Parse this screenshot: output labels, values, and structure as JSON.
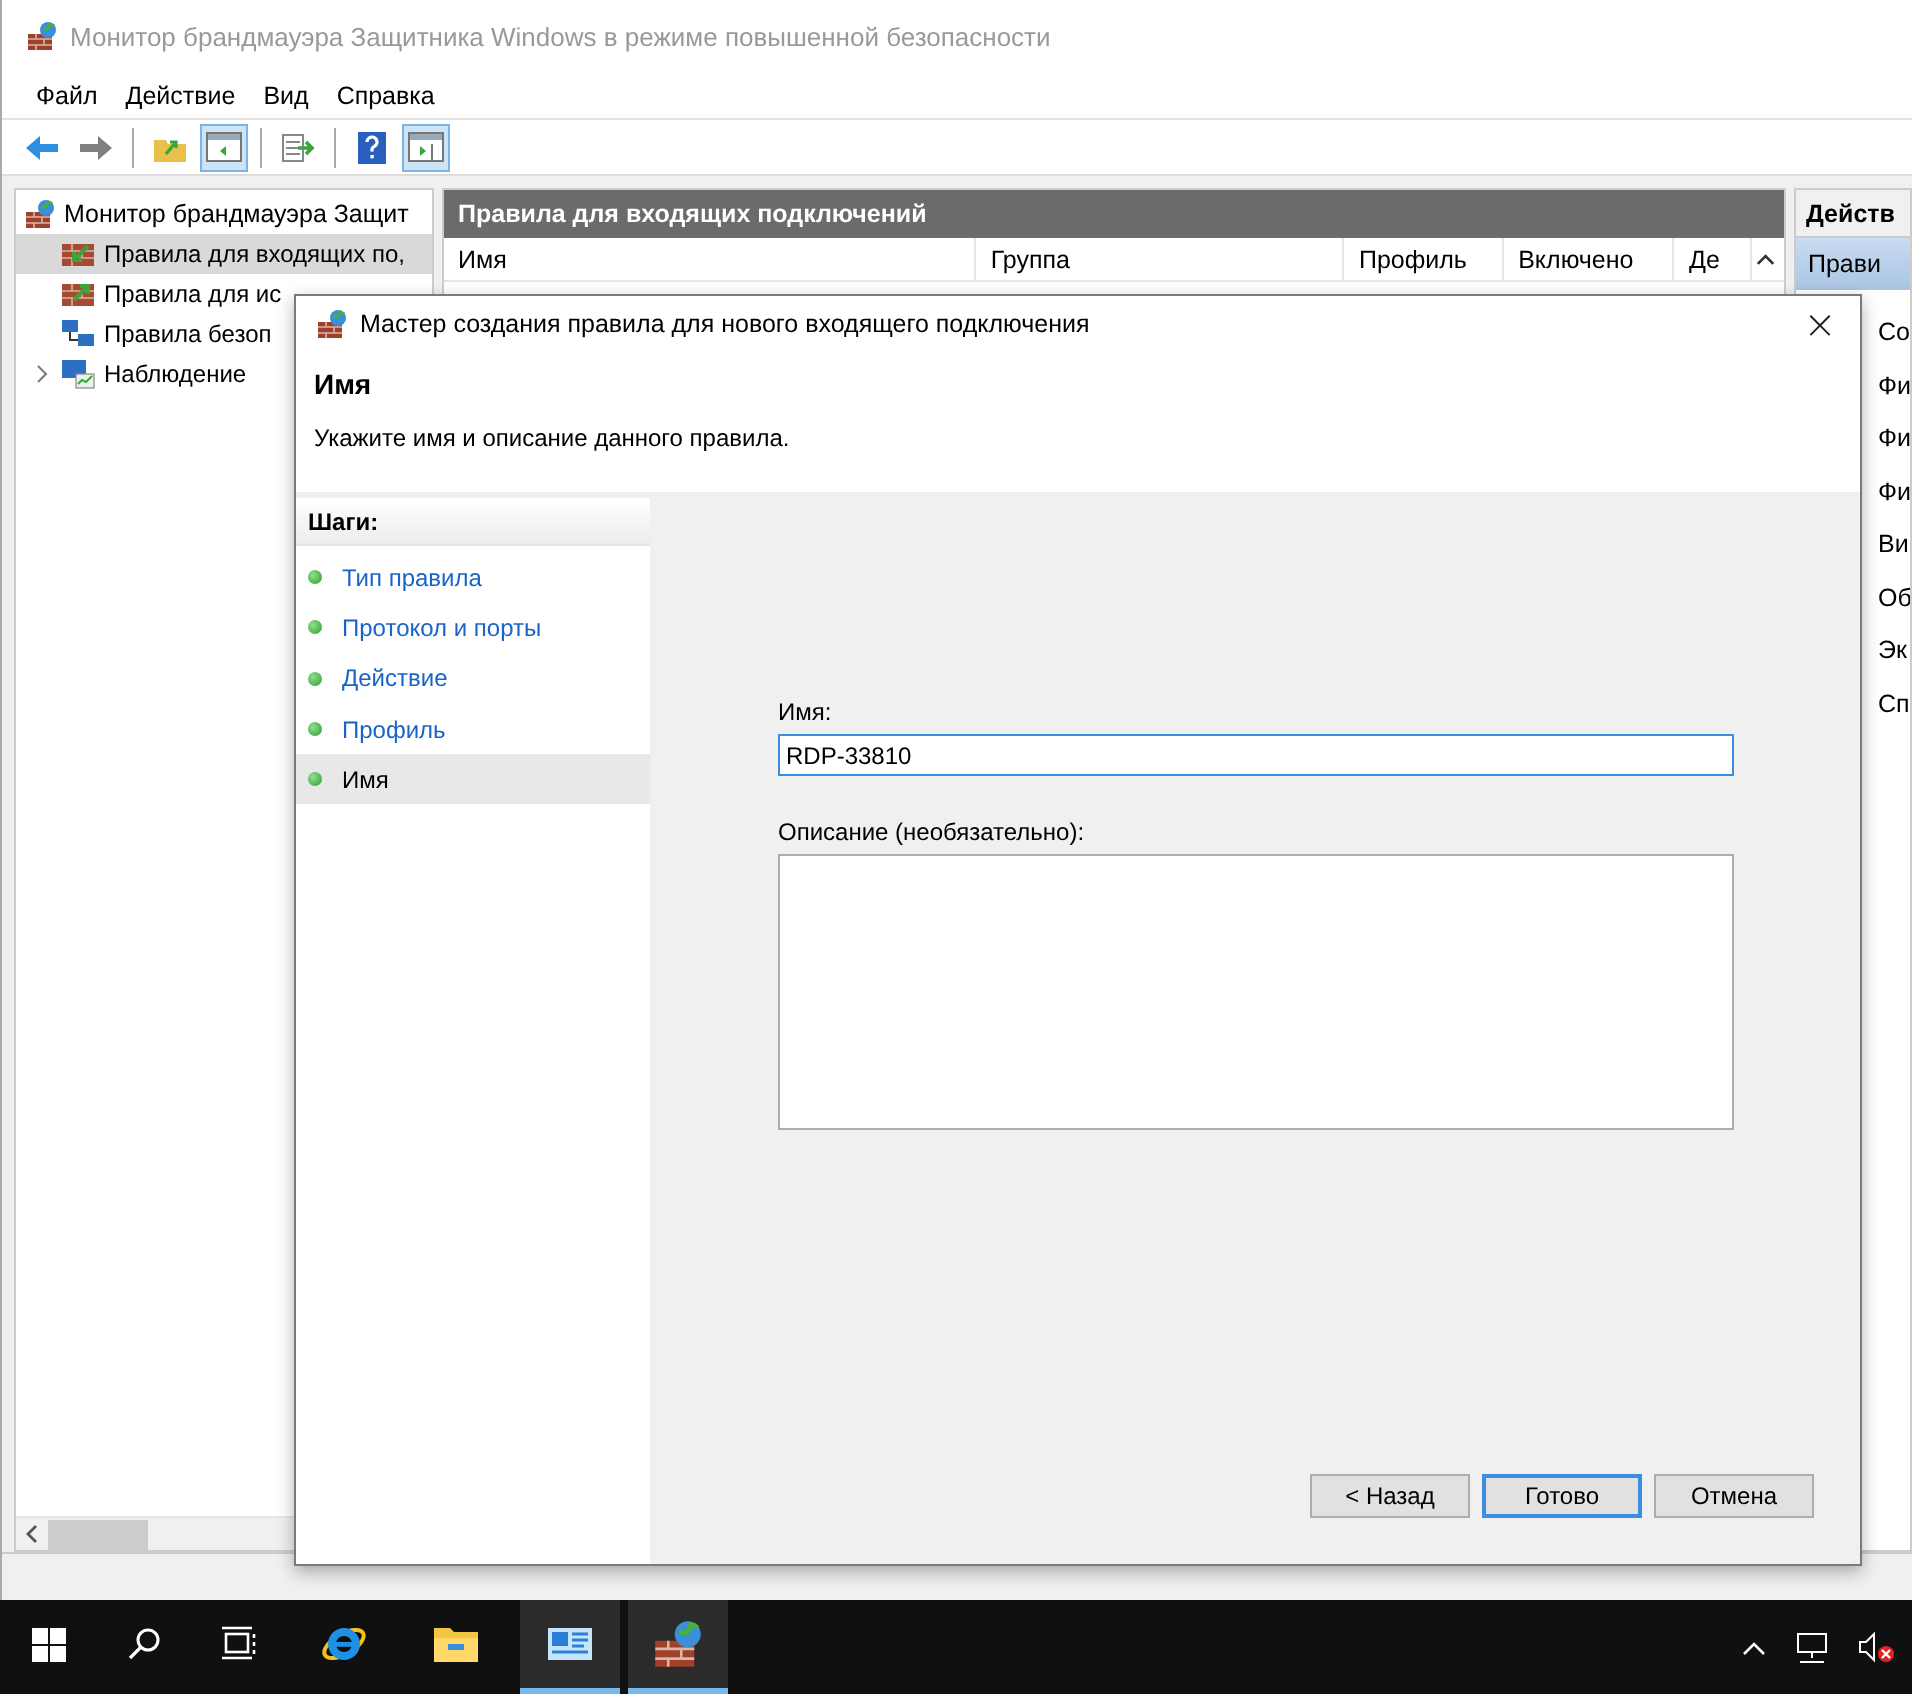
{
  "window": {
    "title": "Монитор брандмауэра Защитника Windows в режиме повышенной безопасности"
  },
  "menu": [
    "Файл",
    "Действие",
    "Вид",
    "Справка"
  ],
  "toolbar": [
    {
      "kind": "back",
      "pressed": false
    },
    {
      "kind": "forward",
      "pressed": false
    },
    {
      "kind": "separator"
    },
    {
      "kind": "up",
      "pressed": false
    },
    {
      "kind": "tree",
      "pressed": true
    },
    {
      "kind": "separator"
    },
    {
      "kind": "export",
      "pressed": false
    },
    {
      "kind": "separator"
    },
    {
      "kind": "help",
      "pressed": false
    },
    {
      "kind": "actions",
      "pressed": true
    }
  ],
  "tree": {
    "label": "Монитор брандмауэра Защит",
    "children": [
      {
        "label": "Правила для входящих по,",
        "kind": "inbound",
        "selected": true,
        "expandable": false
      },
      {
        "label": "Правила для ис",
        "kind": "outbound",
        "selected": false,
        "expandable": false
      },
      {
        "label": "Правила безоп",
        "kind": "security",
        "selected": false,
        "expandable": false
      },
      {
        "label": "Наблюдение",
        "kind": "monitor",
        "selected": false,
        "expandable": true
      }
    ]
  },
  "rules_panel": {
    "title": "Правила для входящих подключений",
    "columns": [
      "Имя",
      "Группа",
      "Профиль",
      "Включено",
      "Де"
    ]
  },
  "actions_panel": {
    "title": "Действ",
    "section": "Прави",
    "items": [
      "Со",
      "Фи",
      "Фи",
      "Фи",
      "Ви",
      "Об",
      "Эк",
      "Сп"
    ]
  },
  "dialog": {
    "title": "Мастер создания правила для нового входящего подключения",
    "close": "×",
    "heading": "Имя",
    "subtitle": "Укажите имя и описание данного правила.",
    "steps_title": "Шаги:",
    "steps": [
      {
        "label": "Тип правила",
        "selected": false
      },
      {
        "label": "Протокол и порты",
        "selected": false
      },
      {
        "label": "Действие",
        "selected": false
      },
      {
        "label": "Профиль",
        "selected": false
      },
      {
        "label": "Имя",
        "selected": true
      }
    ],
    "name_label": "Имя:",
    "name_value": "RDP-33810",
    "description_label": "Описание (необязательно):",
    "buttons": [
      {
        "label": "< Назад",
        "default": false
      },
      {
        "label": "Готово",
        "default": true
      },
      {
        "label": "Отмена",
        "default": false
      }
    ]
  },
  "taskbar": [
    {
      "kind": "start",
      "active": false
    },
    {
      "kind": "search",
      "active": false
    },
    {
      "kind": "taskview",
      "active": false
    },
    {
      "kind": "ie",
      "active": false
    },
    {
      "kind": "explorer",
      "active": false
    },
    {
      "kind": "server",
      "active": true
    },
    {
      "kind": "firewall",
      "active": true
    }
  ]
}
